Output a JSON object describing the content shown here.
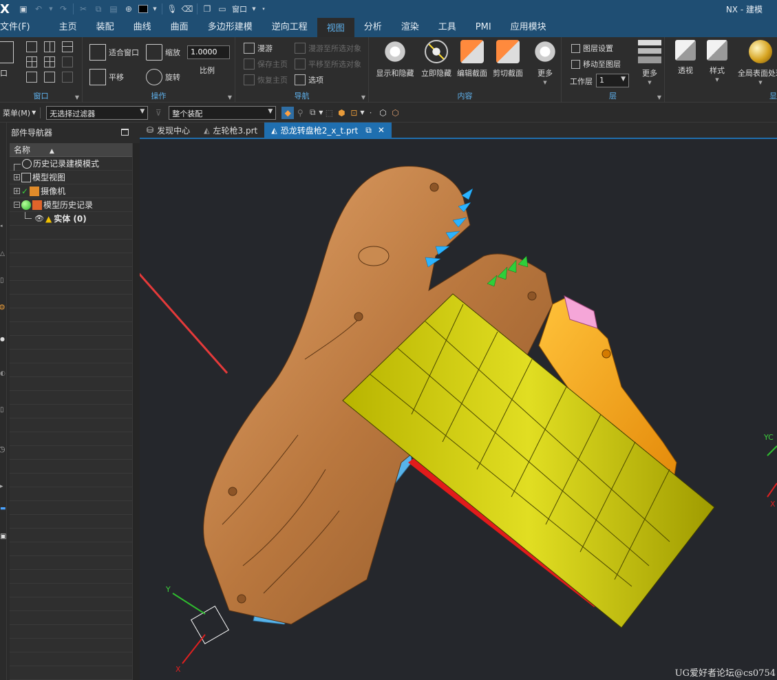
{
  "app": {
    "logo": "X",
    "window_title": "NX - 建模"
  },
  "quick_access": {
    "window_menu": "窗口"
  },
  "menu": {
    "file": "文件(F)",
    "tabs": [
      "主页",
      "装配",
      "曲线",
      "曲面",
      "多边形建模",
      "逆向工程",
      "视图",
      "分析",
      "渲染",
      "工具",
      "PMI",
      "应用模块"
    ],
    "active": "视图"
  },
  "ribbon": {
    "window": {
      "label": "窗口",
      "partial": "口"
    },
    "operation": {
      "label": "操作",
      "fit": "适合窗口",
      "zoom": "缩放",
      "scale_value": "1.0000",
      "scale_label": "比例",
      "pan": "平移",
      "rotate": "旋转"
    },
    "navigation": {
      "label": "导航",
      "roam": "漫游",
      "roam_selected": "漫游至所选对象",
      "save_home": "保存主页",
      "pan_selected": "平移至所选对象",
      "restore_home": "恢复主页",
      "options": "选项"
    },
    "content": {
      "label": "内容",
      "show_hide": "显示和隐藏",
      "instant_hide": "立即隐藏",
      "edit_section": "编辑截面",
      "clip_section": "剪切截面",
      "more": "更多"
    },
    "layer": {
      "label": "层",
      "settings": "图层设置",
      "move_to_layer": "移动至图层",
      "work_layer_label": "工作层",
      "work_layer_value": "1",
      "more": "更多"
    },
    "display": {
      "perspective": "透视",
      "style": "样式",
      "global_surface": "全局表面处理",
      "partial_label": "显"
    }
  },
  "toolbar": {
    "menu": "菜单(M)",
    "filter": "无选择过滤器",
    "scope": "整个装配"
  },
  "navigator": {
    "title": "部件导航器",
    "column": "名称",
    "rows": [
      "历史记录建模模式",
      "模型视图",
      "摄像机",
      "模型历史记录",
      "实体 (0)"
    ]
  },
  "tabs": [
    "发现中心",
    "左轮枪3.prt",
    "恐龙转盘枪2_x_t.prt"
  ],
  "viewport": {
    "triad": {
      "x": "X",
      "y": "Y"
    },
    "axis_right": {
      "yc": "YC",
      "xc": "X"
    },
    "watermark": "UG爱好者论坛@cs0754"
  }
}
